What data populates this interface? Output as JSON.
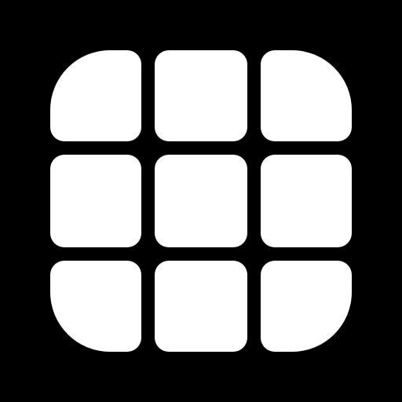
{
  "icon": {
    "name": "grid-3x3-icon",
    "background_color": "#000000",
    "tile_color": "#FFFFFF",
    "rows": 3,
    "columns": 3
  }
}
